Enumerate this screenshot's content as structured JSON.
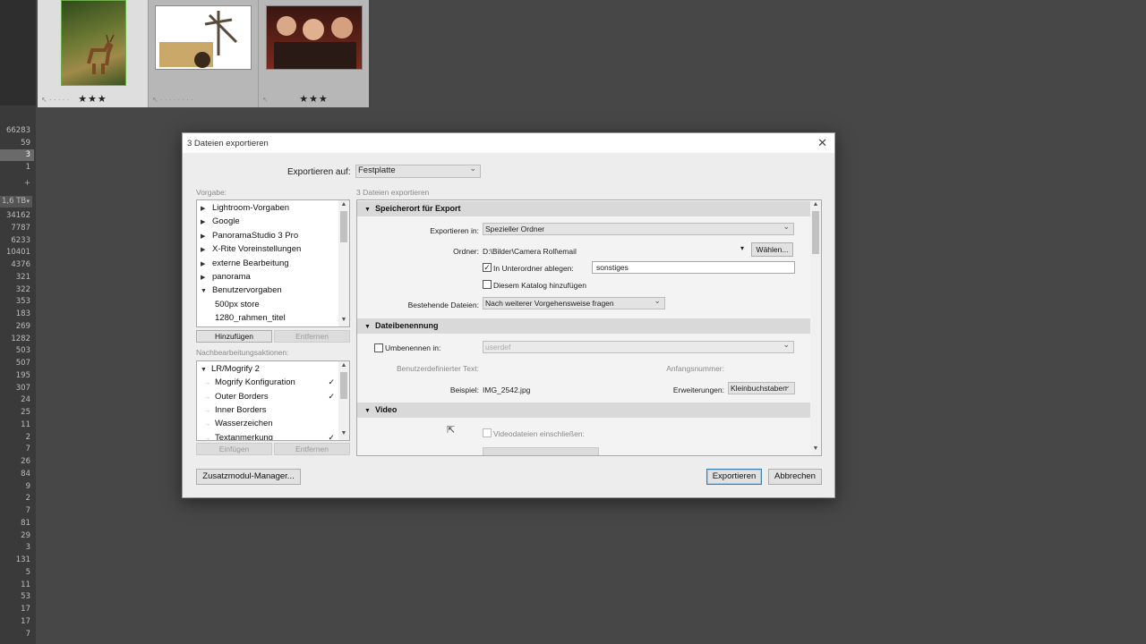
{
  "left_column": {
    "numbers": [
      "66283",
      "59",
      "3",
      "1",
      "+",
      "34162",
      "7787",
      "6233",
      "10401",
      "4376",
      "321",
      "322",
      "353",
      "183",
      "269",
      "1282",
      "503",
      "507",
      "195",
      "307",
      "24",
      "25",
      "11",
      "2",
      "7",
      "26",
      "84",
      "9",
      "2",
      "7",
      "81",
      "29",
      "3",
      "131",
      "5",
      "11",
      "53",
      "17",
      "17",
      "7"
    ],
    "selected_value": "3",
    "tb_label": "1,6 TB"
  },
  "filmstrip": {
    "cells": [
      {
        "stars": "★★★",
        "color": "#4a6a2a"
      },
      {
        "stars": "",
        "color": "#d9c9a8"
      },
      {
        "stars": "★★★",
        "color": "#6b2a1e"
      }
    ]
  },
  "dialog": {
    "title": "3 Dateien exportieren",
    "export_to_label": "Exportieren auf:",
    "export_to_value": "Festplatte",
    "preset_label": "Vorgabe:",
    "header_right": "3 Dateien exportieren",
    "presets": [
      {
        "label": "Lightroom-Vorgaben",
        "arrow": "▶"
      },
      {
        "label": "Google",
        "arrow": "▶"
      },
      {
        "label": "PanoramaStudio 3 Pro",
        "arrow": "▶"
      },
      {
        "label": "X-Rite Voreinstellungen",
        "arrow": "▶"
      },
      {
        "label": "externe Bearbeitung",
        "arrow": "▶"
      },
      {
        "label": "panorama",
        "arrow": "▶"
      },
      {
        "label": "Benutzervorgaben",
        "arrow": "▼"
      },
      {
        "label": "500px store",
        "arrow": ""
      },
      {
        "label": "1280_rahmen_titel",
        "arrow": ""
      }
    ],
    "add_button": "Hinzufügen",
    "remove_button": "Entfernen",
    "post_label": "Nachbearbeitungsaktionen:",
    "actions": [
      {
        "label": "LR/Mogrify 2",
        "arrow": "▼",
        "check": ""
      },
      {
        "label": "Mogrify Konfiguration",
        "arrow": "→",
        "check": "✓"
      },
      {
        "label": "Outer Borders",
        "arrow": "→",
        "check": "✓"
      },
      {
        "label": "Inner Borders",
        "arrow": "→",
        "check": ""
      },
      {
        "label": "Wasserzeichen",
        "arrow": "→",
        "check": ""
      },
      {
        "label": "Textanmerkung",
        "arrow": "→",
        "check": "✓"
      }
    ],
    "insert_button": "Einfügen",
    "remove_button2": "Entfernen",
    "plugin_manager": "Zusatzmodul-Manager...",
    "export_button": "Exportieren",
    "cancel_button": "Abbrechen",
    "sections": {
      "location": {
        "title": "Speicherort für Export",
        "export_in_label": "Exportieren in:",
        "export_in_value": "Spezieller Ordner",
        "folder_label": "Ordner:",
        "folder_value": "D:\\Bilder\\Camera Roll\\email",
        "choose_button": "Wählen...",
        "subfolder_label": "In Unterordner ablegen:",
        "subfolder_value": "sonstiges",
        "catalog_label": "Diesem Katalog hinzufügen",
        "existing_label": "Bestehende Dateien:",
        "existing_value": "Nach weiterer Vorgehensweise fragen"
      },
      "naming": {
        "title": "Dateibenennung",
        "rename_label": "Umbenennen in:",
        "rename_value": "userdef",
        "custom_text_label": "Benutzerdefinierter Text:",
        "start_number_label": "Anfangsnummer:",
        "example_label": "Beispiel:",
        "example_value": "IMG_2542.jpg",
        "ext_label": "Erweiterungen:",
        "ext_value": "Kleinbuchstaben"
      },
      "video": {
        "title": "Video",
        "include_label": "Videodateien einschließen:"
      }
    }
  }
}
